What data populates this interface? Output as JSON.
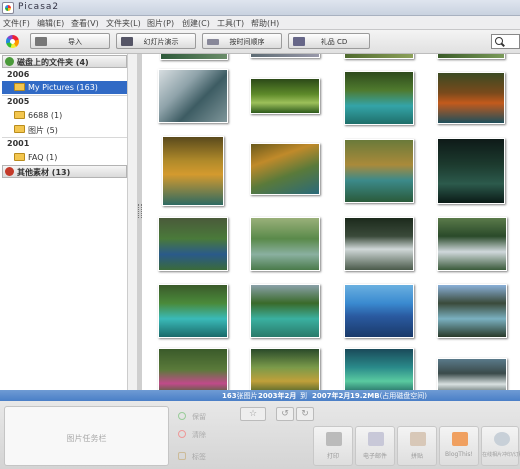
{
  "window": {
    "title": "Picasa2"
  },
  "menu": [
    "文件(F)",
    "编辑(E)",
    "查看(V)",
    "文件夹(L)",
    "图片(P)",
    "创建(C)",
    "工具(T)",
    "帮助(H)"
  ],
  "toolbar": {
    "import_label": "导入",
    "slideshow_label": "幻灯片演示",
    "timeline_label": "按时间顺序",
    "giftcd_label": "礼品 CD"
  },
  "sidebar": {
    "local_header": "磁盘上的文件夹 (4)",
    "years": [
      {
        "year": "2006",
        "folders": [
          {
            "name": "My Pictures (163)",
            "selected": true
          }
        ]
      },
      {
        "year": "2005",
        "folders": [
          {
            "name": "6688 (1)"
          },
          {
            "name": "图片 (5)"
          }
        ]
      },
      {
        "year": "2001",
        "folders": [
          {
            "name": "FAQ (1)"
          }
        ]
      }
    ],
    "other_header": "其他素材 (13)"
  },
  "status": {
    "count": "163",
    "count_suffix": "张图片",
    "date_from": "2003年2月",
    "date_to_prefix": "到",
    "date_to": "2007年2月",
    "size": "19.2MB",
    "size_suffix": "(占用磁盘空间)"
  },
  "bottom": {
    "tray_label": "图片任务栏",
    "actions": [
      "保留",
      "清除",
      "标签"
    ],
    "buttons": [
      "打印",
      "电子邮件",
      "拼贴",
      "BlogThis!",
      "在线相片冲印/订购"
    ]
  },
  "colors": {
    "accent": "#316ac5",
    "status_bar": "#5a8acb",
    "sidebar_bg": "#ffffff"
  },
  "icons": [
    "picasa-logo-icon",
    "import-icon",
    "slideshow-icon",
    "timeline-icon",
    "cd-icon",
    "search-icon",
    "folder-icon",
    "collapse-icon",
    "expand-icon"
  ]
}
